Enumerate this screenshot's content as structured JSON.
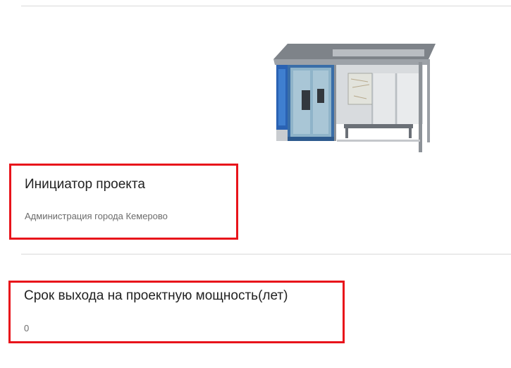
{
  "project": {
    "image_icon": "bus-stop-pavilion-image",
    "initiator": {
      "title": "Инициатор проекта",
      "value": "Администрация города Кемерово"
    },
    "capacity_term": {
      "title": "Срок выхода на проектную мощность(лет)",
      "value": "0"
    }
  },
  "colors": {
    "highlight_border": "#e8141b",
    "divider": "#d9d9d9",
    "title_text": "#222222",
    "value_text": "#6c6c6c"
  }
}
